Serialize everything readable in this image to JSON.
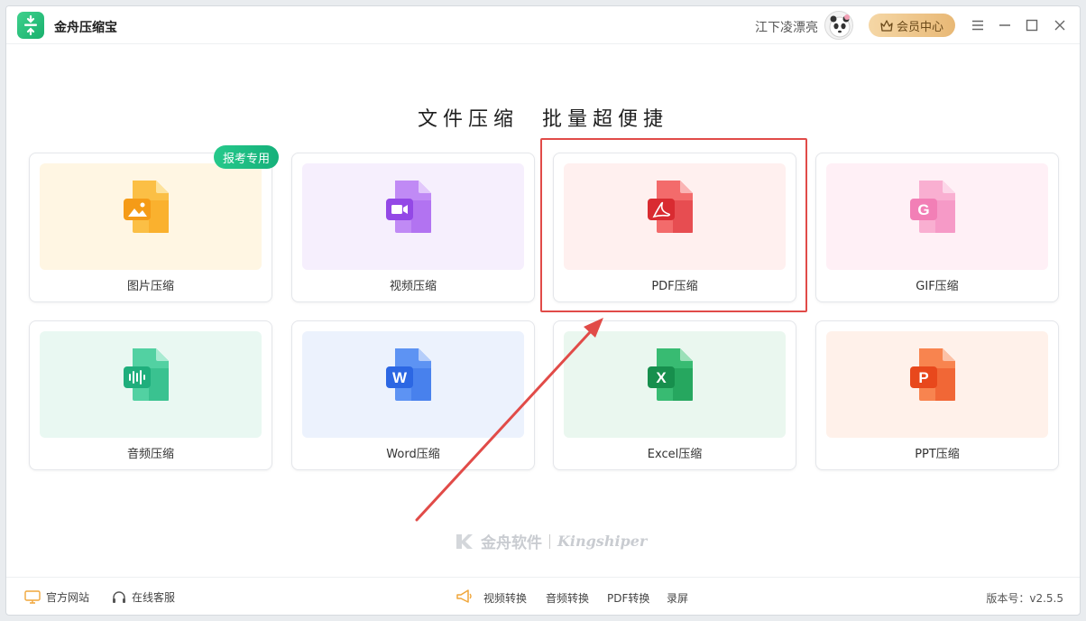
{
  "titlebar": {
    "app_title": "金舟压缩宝",
    "username": "江下凌漂亮",
    "vip_label": "会员中心",
    "icons": {
      "logo": "app-logo",
      "avatar": "panda-avatar",
      "vip": "crown-icon",
      "menu": "menu-icon",
      "minimize": "minimize-icon",
      "maximize": "maximize-icon",
      "close": "close-icon"
    }
  },
  "main": {
    "headline": "文件压缩  批量超便捷",
    "badge": "报考专用",
    "cards": [
      {
        "label": "图片压缩",
        "icon": "image-file-icon",
        "panel_color": "#fff6e3",
        "accent": "#f7a722"
      },
      {
        "label": "视频压缩",
        "icon": "video-file-icon",
        "panel_color": "#f6effd",
        "accent": "#a35ff0"
      },
      {
        "label": "PDF压缩",
        "icon": "pdf-file-icon",
        "panel_color": "#fff0ef",
        "accent": "#e5383d"
      },
      {
        "label": "GIF压缩",
        "icon": "gif-file-icon",
        "panel_color": "#fff0f6",
        "accent": "#f28bbd"
      },
      {
        "label": "音频压缩",
        "icon": "audio-file-icon",
        "panel_color": "#e9f8f2",
        "accent": "#25b987"
      },
      {
        "label": "Word压缩",
        "icon": "word-file-icon",
        "panel_color": "#ecf2fd",
        "accent": "#3a77ec"
      },
      {
        "label": "Excel压缩",
        "icon": "excel-file-icon",
        "panel_color": "#eaf7ef",
        "accent": "#1fa45c"
      },
      {
        "label": "PPT压缩",
        "icon": "ppt-file-icon",
        "panel_color": "#fff1ea",
        "accent": "#f05a2c"
      }
    ],
    "watermark": {
      "cn": "金舟软件",
      "en": "Kingshiper"
    }
  },
  "footer": {
    "official_site": "官方网站",
    "online_service": "在线客服",
    "links": [
      "视频转换",
      "音频转换",
      "PDF转换",
      "录屏"
    ],
    "version": "版本号：v2.5.5",
    "icons": {
      "site": "monitor-icon",
      "service": "headset-icon",
      "promo": "megaphone-icon"
    }
  },
  "colors": {
    "highlight": "#e14b48",
    "brand": "#19b06d"
  }
}
